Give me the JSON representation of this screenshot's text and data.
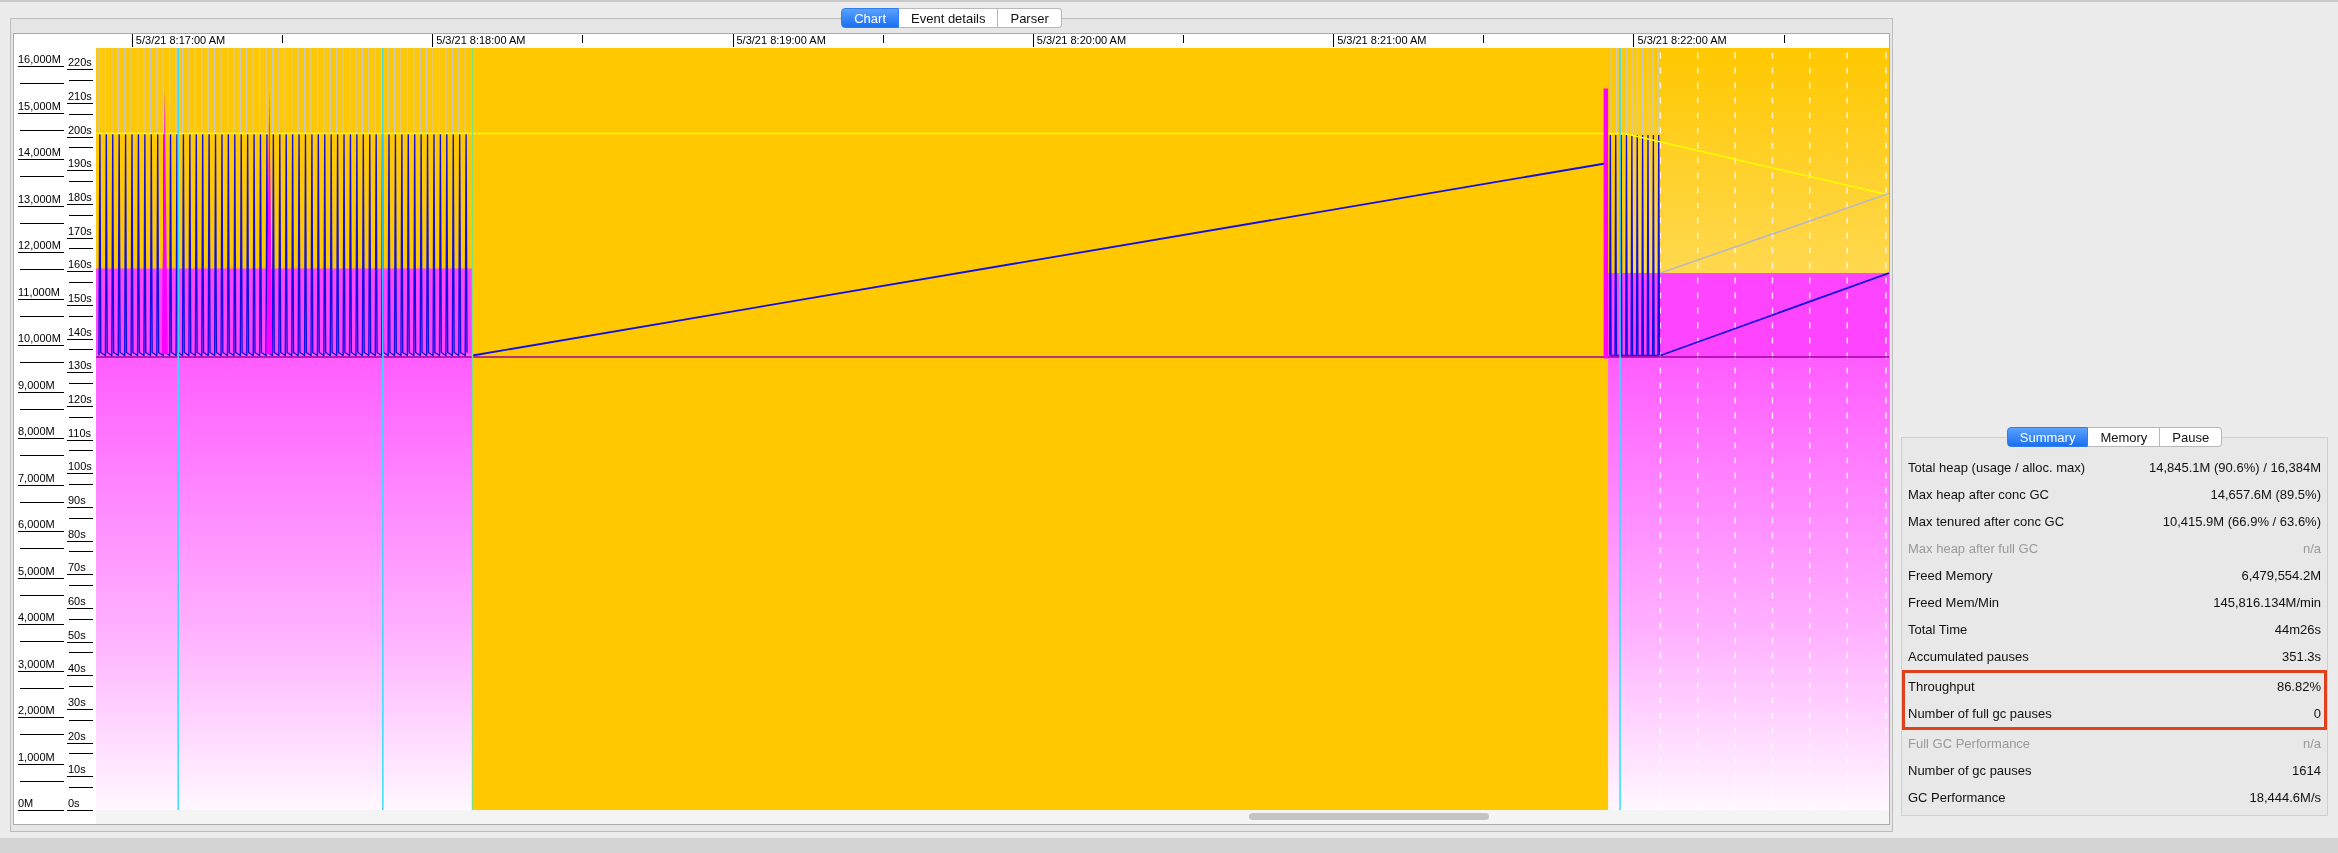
{
  "chart_tabs": [
    {
      "label": "Chart",
      "selected": true
    },
    {
      "label": "Event details",
      "selected": false
    },
    {
      "label": "Parser",
      "selected": false
    }
  ],
  "time_axis": {
    "labels": [
      "5/3/21 8:17:00 AM",
      "5/3/21 8:18:00 AM",
      "5/3/21 8:19:00 AM",
      "5/3/21 8:20:00 AM",
      "5/3/21 8:21:00 AM",
      "5/3/21 8:22:00 AM"
    ]
  },
  "memory_axis": {
    "labels": [
      "16,000M",
      "15,000M",
      "14,000M",
      "13,000M",
      "12,000M",
      "11,000M",
      "10,000M",
      "9,000M",
      "8,000M",
      "7,000M",
      "6,000M",
      "5,000M",
      "4,000M",
      "3,000M",
      "2,000M",
      "1,000M",
      "0M"
    ]
  },
  "pause_axis": {
    "labels": [
      "220s",
      "210s",
      "200s",
      "190s",
      "180s",
      "170s",
      "160s",
      "150s",
      "140s",
      "130s",
      "120s",
      "110s",
      "100s",
      "90s",
      "80s",
      "70s",
      "60s",
      "50s",
      "40s",
      "30s",
      "20s",
      "10s",
      "0s"
    ]
  },
  "summary_tabs": [
    {
      "label": "Summary",
      "selected": true
    },
    {
      "label": "Memory",
      "selected": false
    },
    {
      "label": "Pause",
      "selected": false
    }
  ],
  "summary_rows": [
    {
      "label": "Total heap (usage / alloc. max)",
      "value": "14,845.1M (90.6%) / 16,384M",
      "disabled": false,
      "highlighted": false
    },
    {
      "label": "Max heap after conc GC",
      "value": "14,657.6M (89.5%)",
      "disabled": false,
      "highlighted": false
    },
    {
      "label": "Max tenured after conc GC",
      "value": "10,415.9M (66.9% / 63.6%)",
      "disabled": false,
      "highlighted": false
    },
    {
      "label": "Max heap after full GC",
      "value": "n/a",
      "disabled": true,
      "highlighted": false
    },
    {
      "label": "Freed Memory",
      "value": "6,479,554.2M",
      "disabled": false,
      "highlighted": false
    },
    {
      "label": "Freed Mem/Min",
      "value": "145,816.134M/min",
      "disabled": false,
      "highlighted": false
    },
    {
      "label": "Total Time",
      "value": "44m26s",
      "disabled": false,
      "highlighted": false
    },
    {
      "label": "Accumulated pauses",
      "value": "351.3s",
      "disabled": false,
      "highlighted": false
    },
    {
      "label": "Throughput",
      "value": "86.82%",
      "disabled": false,
      "highlighted": true
    },
    {
      "label": "Number of full gc pauses",
      "value": "0",
      "disabled": false,
      "highlighted": true
    },
    {
      "label": "Full GC Performance",
      "value": "n/a",
      "disabled": true,
      "highlighted": false
    },
    {
      "label": "Number of gc pauses",
      "value": "1614",
      "disabled": false,
      "highlighted": false
    },
    {
      "label": "GC Performance",
      "value": "18,444.6M/s",
      "disabled": false,
      "highlighted": false
    }
  ]
}
